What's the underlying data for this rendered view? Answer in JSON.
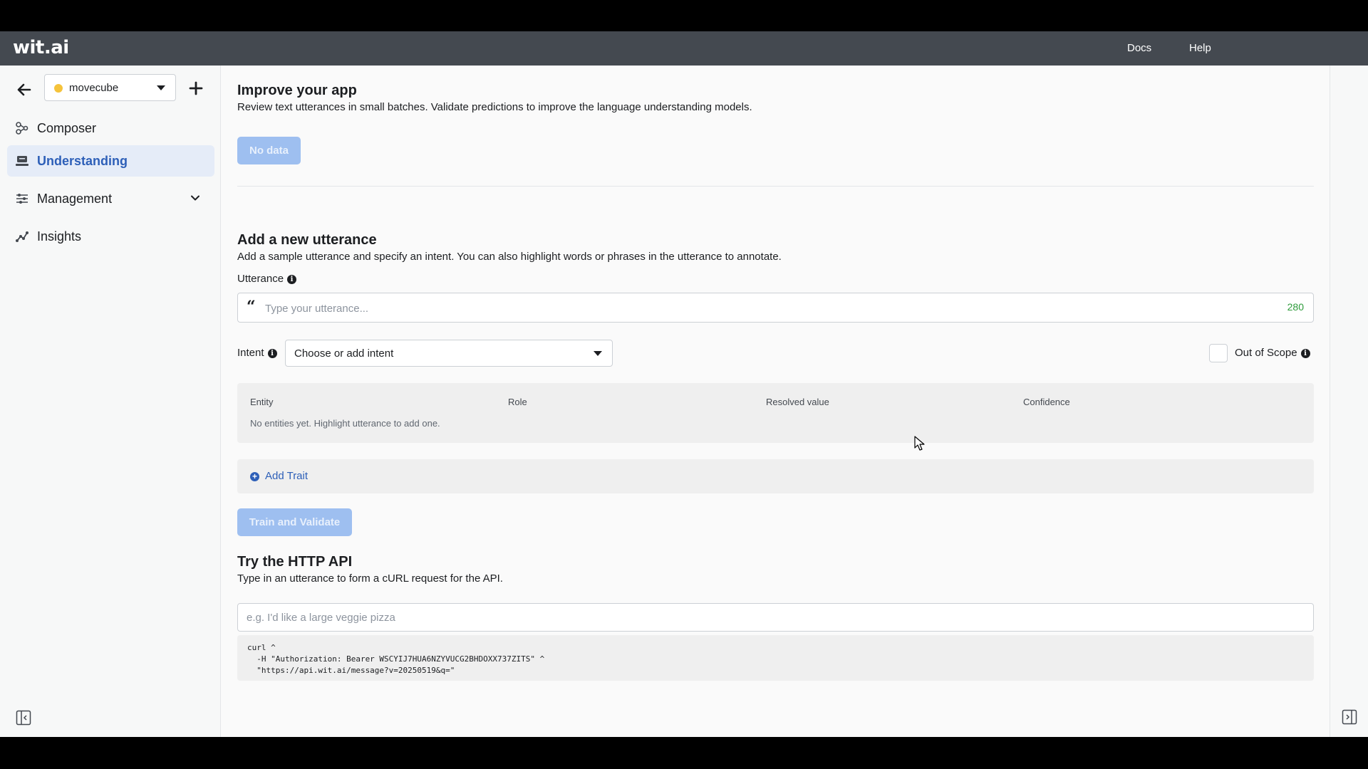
{
  "topbar": {
    "logo": "wit.ai",
    "links": [
      "Docs",
      "Help"
    ]
  },
  "sidebar": {
    "app_name": "movecube",
    "app_dot_color": "#f5c33b",
    "nav": [
      {
        "label": "Composer",
        "icon": "composer-icon",
        "active": false
      },
      {
        "label": "Understanding",
        "icon": "understanding-icon",
        "active": true
      },
      {
        "label": "Management",
        "icon": "management-icon",
        "active": false
      },
      {
        "label": "Insights",
        "icon": "insights-icon",
        "active": false
      }
    ]
  },
  "improve": {
    "title": "Improve your app",
    "description": "Review text utterances in small batches. Validate predictions to improve the language understanding models.",
    "button": "No data"
  },
  "add_utterance": {
    "title": "Add a new utterance",
    "description": "Add a sample utterance and specify an intent. You can also highlight words or phrases in the utterance to annotate.",
    "utterance_label": "Utterance",
    "utterance_placeholder": "Type your utterance...",
    "char_count": "280",
    "intent_label": "Intent",
    "intent_placeholder": "Choose or add intent",
    "out_of_scope_label": "Out of Scope",
    "entity_headers": [
      "Entity",
      "Role",
      "Resolved value",
      "Confidence"
    ],
    "entity_empty": "No entities yet. Highlight utterance to add one.",
    "add_trait": "Add Trait",
    "train_button": "Train and Validate"
  },
  "http_api": {
    "title": "Try the HTTP API",
    "description": "Type in an utterance to form a cURL request for the API.",
    "input_placeholder": "e.g. I'd like a large veggie pizza",
    "curl": "curl ^\n  -H \"Authorization: Bearer WSCYIJ7HUA6NZYVUCG2BHDOXX737ZITS\" ^\n  \"https://api.wit.ai/message?v=20250519&q=\""
  },
  "colors": {
    "topbar": "#444950",
    "accent": "#2d5fb8",
    "disabled_button": "#9ebff0",
    "char_count": "#2e9b3b"
  }
}
